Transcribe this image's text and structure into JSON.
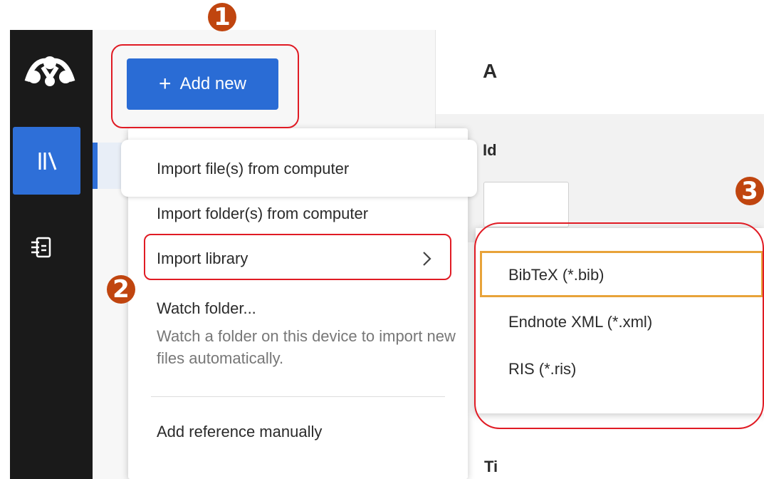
{
  "toolbar": {
    "add_new_label": "Add new"
  },
  "main": {
    "header_partial": "A",
    "label_partial_1": "Id",
    "label_partial_2": "Ti"
  },
  "add_menu": {
    "items": [
      {
        "label": "Import file(s) from computer"
      },
      {
        "label": "Import folder(s) from computer"
      },
      {
        "label": "Import library"
      },
      {
        "label": "Watch folder..."
      },
      {
        "label": "Add reference manually"
      }
    ],
    "watch_description": "Watch a folder on this device to import new files automatically."
  },
  "import_library_submenu": {
    "items": [
      {
        "label": "BibTeX (*.bib)",
        "selected": true
      },
      {
        "label": "Endnote XML (*.xml)"
      },
      {
        "label": "RIS (*.ris)"
      }
    ]
  },
  "annotations": {
    "badges": [
      "1",
      "2",
      "3"
    ],
    "badge_color": "#c0450f",
    "outline_color": "#e01b24"
  },
  "colors": {
    "accent": "#2a6cd5",
    "rail": "#1a1a1a",
    "selected_outline": "#e8a33a"
  },
  "icons": {
    "logo": "mendeley-logo-icon",
    "library": "library-icon",
    "notebook": "notebook-icon",
    "plus": "plus-icon",
    "chevron": "chevron-right-icon"
  }
}
